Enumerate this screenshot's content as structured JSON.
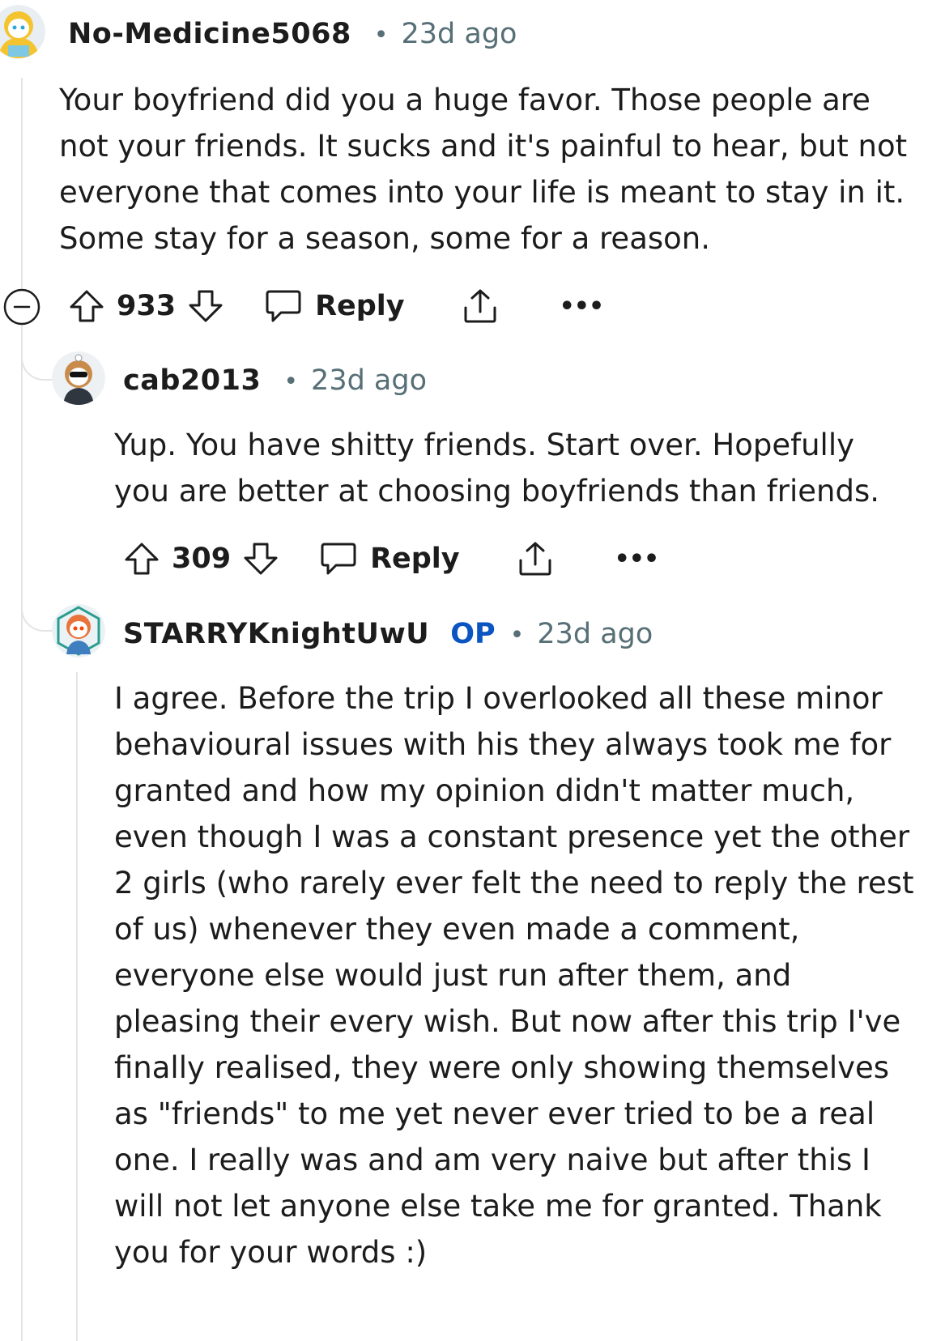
{
  "comments": [
    {
      "username": "No-Medicine5068",
      "separator": "•",
      "time": "23d ago",
      "body": "Your boyfriend did you a huge favor. Those people are not your friends. It sucks and it's painful to hear, but not everyone that comes into your life is meant to stay in it. Some stay for a season, some for a reason.",
      "score": "933",
      "reply_label": "Reply",
      "more_label": "•••",
      "avatar_icon": "reddit-avatar-yellow-hood-icon"
    },
    {
      "username": "cab2013",
      "separator": "•",
      "time": "23d ago",
      "body": "Yup. You have shitty friends. Start over. Hopefully you are better at choosing boyfriends than friends.",
      "score": "309",
      "reply_label": "Reply",
      "more_label": "•••",
      "avatar_icon": "reddit-avatar-sunglasses-icon"
    },
    {
      "username": "STARRYKnightUwU",
      "op_badge": "OP",
      "separator": "•",
      "time": "23d ago",
      "body": "I agree. Before the trip I overlooked all these minor behavioural issues with his they always took me for granted and how my opinion didn't matter much, even though I was a constant presence yet the other 2 girls (who rarely ever felt the need to reply the rest of us) whenever they even made a comment, everyone else would just run after them, and pleasing their every wish. But now after this trip I've finally realised, they were only showing themselves as \"friends\" to me yet never ever tried to be a real one. I really was and am very naive but after this I will not let anyone else take me for granted. Thank you for your words :)",
      "avatar_icon": "reddit-avatar-orange-hair-icon"
    }
  ],
  "colors": {
    "text": "#1c1c1c",
    "meta": "#576f76",
    "op_badge": "#0a55c2",
    "thread_line": "#e2e4e6"
  }
}
